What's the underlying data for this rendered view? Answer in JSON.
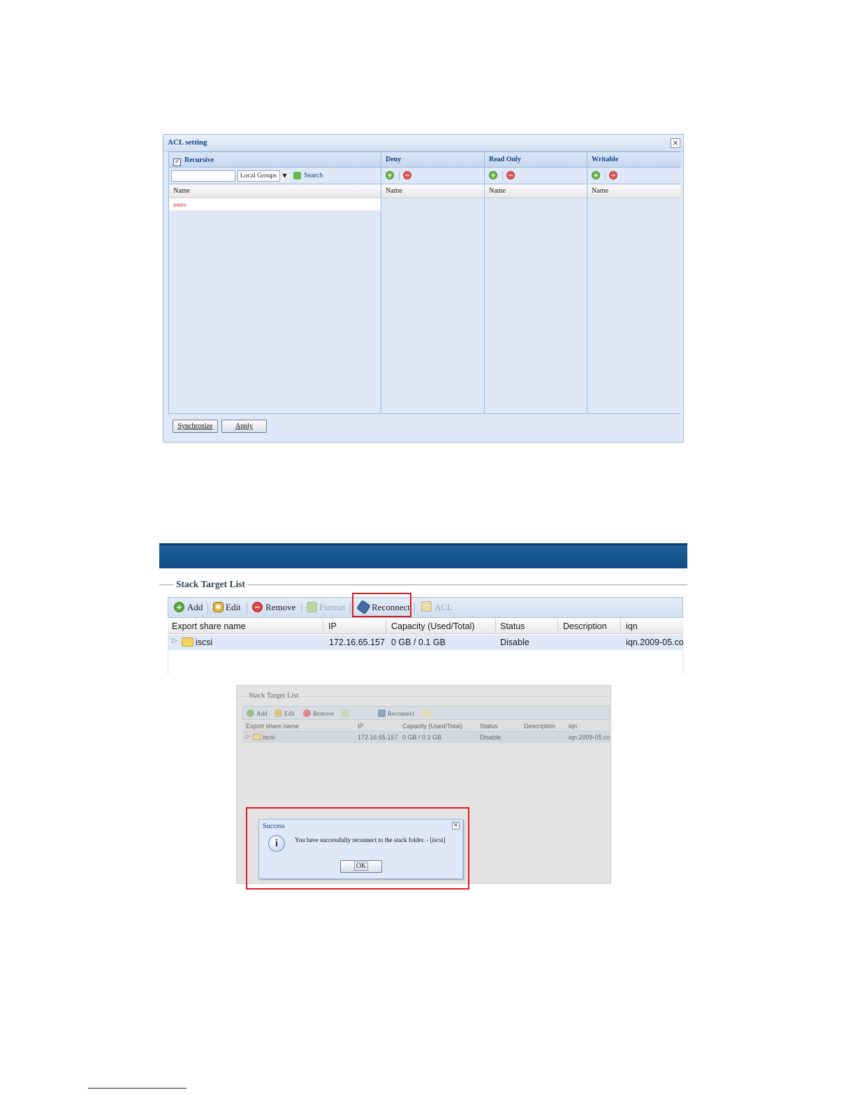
{
  "acl": {
    "title": "ACL setting",
    "recursive_label": "Recursive",
    "recursive_checked": true,
    "search_placeholder": "",
    "group_select": "Local Groups",
    "search_label": "Search",
    "name_header": "Name",
    "items": [
      "users"
    ],
    "panels": [
      {
        "title": "Deny",
        "name_header": "Name"
      },
      {
        "title": "Read Only",
        "name_header": "Name"
      },
      {
        "title": "Writable",
        "name_header": "Name"
      }
    ],
    "buttons": {
      "sync": "Synchronize",
      "apply": "Apply"
    }
  },
  "stack": {
    "title": "Stack Target List",
    "toolbar": {
      "add": "Add",
      "edit": "Edit",
      "remove": "Remove",
      "format": "Format",
      "reconnect": "Reconnect",
      "acl": "ACL"
    },
    "highlighted": "Reconnect",
    "columns": [
      "Export share name",
      "IP",
      "Capacity (Used/Total)",
      "Status",
      "Description",
      "iqn"
    ],
    "rows": [
      {
        "name": "iscsi",
        "ip": "172.16.65.157",
        "capacity": "0 GB / 0.1 GB",
        "status": "Disable",
        "description": "",
        "iqn": "iqn.2009-05.co"
      }
    ]
  },
  "stack_small": {
    "title": "Stack Target List",
    "toolbar": {
      "add": "Add",
      "edit": "Edit",
      "remove": "Remove",
      "reconnect": "Reconnect"
    },
    "columns": [
      "Export share name",
      "IP",
      "Capacity (Used/Total)",
      "Status",
      "Description",
      "iqn"
    ],
    "rows": [
      {
        "name": "iscsi",
        "ip": "172.16.65.157",
        "capacity": "0 GB / 0.1 GB",
        "status": "Disable",
        "iqn": "iqn.2009-05.co"
      }
    ]
  },
  "dialog": {
    "title": "Success",
    "message": "You have successfully reconnect to the stack folder. - [iscsi]",
    "ok": "OK"
  },
  "colors": {
    "highlight": "#e01b1b",
    "header_blue": "#15428b",
    "bar_blue": "#1f5f98"
  }
}
